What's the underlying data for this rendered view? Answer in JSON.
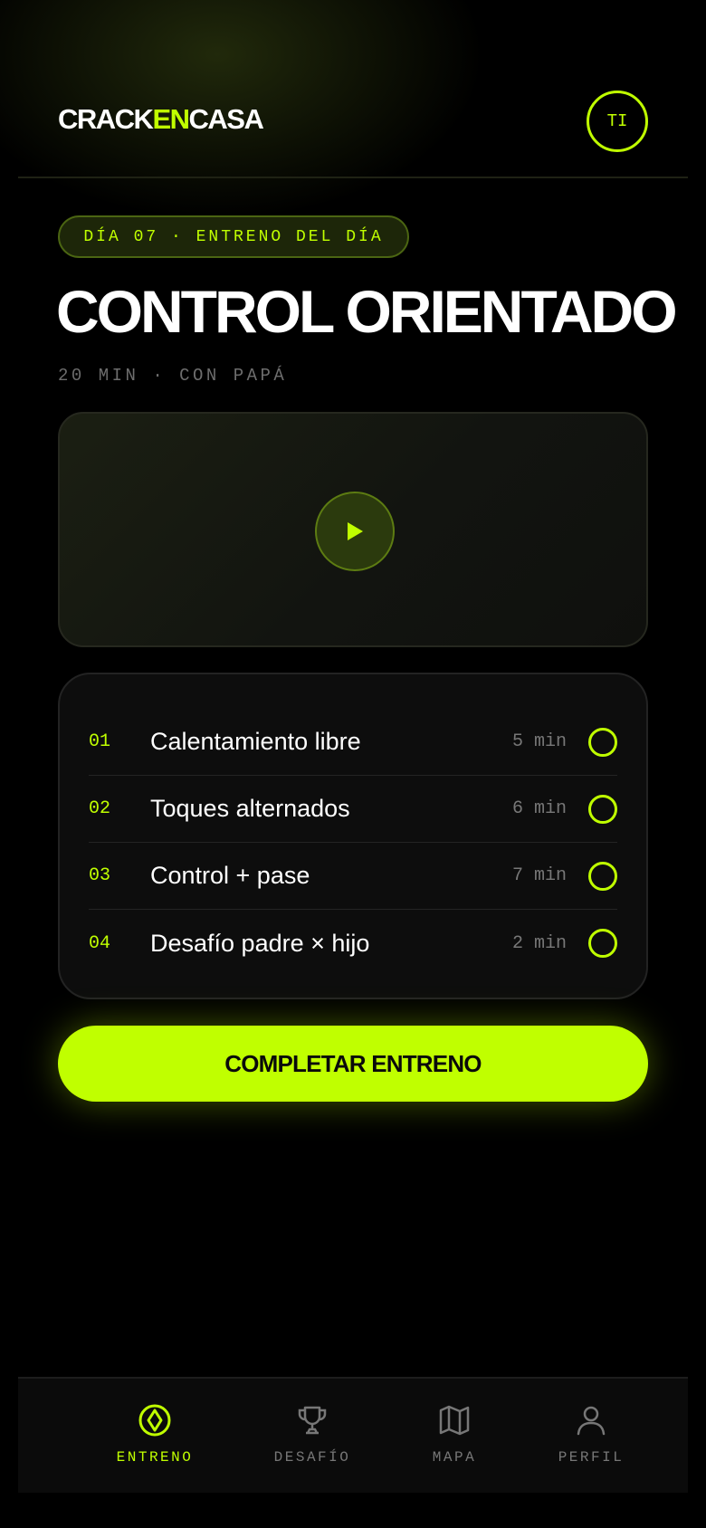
{
  "header": {
    "logo": {
      "part1": "CRACK",
      "part2": "EN",
      "part3": "CASA"
    },
    "avatar_initials": "TI"
  },
  "day_badge": "DÍA 07 · ENTRENO DEL DÍA",
  "title": "CONTROL ORIENTADO",
  "subtitle": "20 MIN · CON PAPÁ",
  "video": {
    "icon": "play-icon"
  },
  "exercises": [
    {
      "num": "01",
      "name": "Calentamiento libre",
      "duration": "5 min",
      "done": false
    },
    {
      "num": "02",
      "name": "Toques alternados",
      "duration": "6 min",
      "done": false
    },
    {
      "num": "03",
      "name": "Control + pase",
      "duration": "7 min",
      "done": false
    },
    {
      "num": "04",
      "name": "Desafío padre × hijo",
      "duration": "2 min",
      "done": false
    }
  ],
  "cta_label": "COMPLETAR ENTRENO",
  "nav": [
    {
      "label": "ENTRENO",
      "icon": "diamond-target-icon",
      "active": true
    },
    {
      "label": "DESAFÍO",
      "icon": "trophy-icon",
      "active": false
    },
    {
      "label": "MAPA",
      "icon": "map-icon",
      "active": false
    },
    {
      "label": "PERFIL",
      "icon": "user-icon",
      "active": false
    }
  ],
  "colors": {
    "accent": "#c0ff00",
    "background": "#000000",
    "muted": "#777777"
  }
}
